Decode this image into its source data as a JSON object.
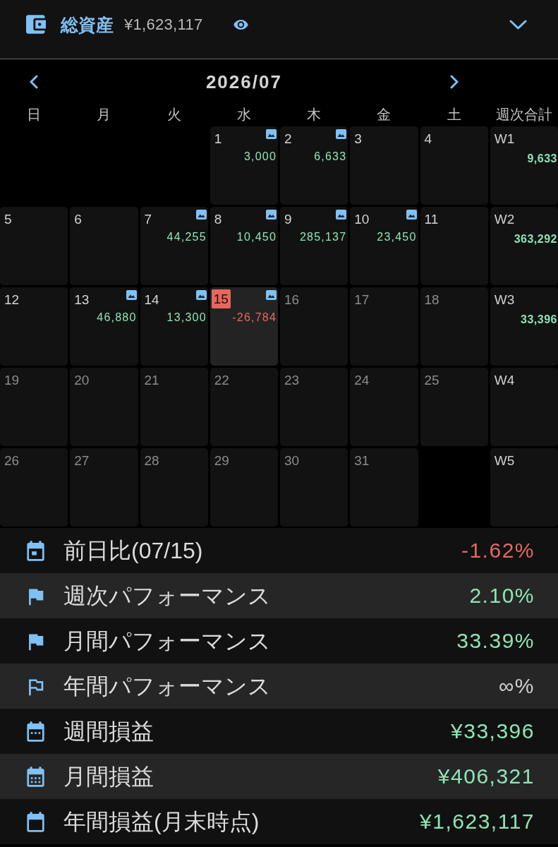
{
  "header": {
    "title": "総資産",
    "amount": "¥1,623,117"
  },
  "calendar": {
    "title": "2026/07",
    "weekdays": [
      "日",
      "月",
      "火",
      "水",
      "木",
      "金",
      "土"
    ],
    "week_total_heading": "週次合計",
    "weeks": [
      {
        "days": [
          {
            "date": "1",
            "value": "3,000",
            "negative": false,
            "has_image": true,
            "dimmed": false,
            "today": false,
            "selected": false
          },
          {
            "date": "2",
            "value": "6,633",
            "negative": false,
            "has_image": true,
            "dimmed": false,
            "today": false,
            "selected": false
          },
          {
            "date": "3",
            "has_image": false,
            "dimmed": false,
            "today": false,
            "selected": false
          },
          {
            "date": "4",
            "has_image": false,
            "dimmed": false,
            "today": false,
            "selected": false
          }
        ],
        "total": {
          "label": "W1",
          "value": "9,633",
          "negative": false
        }
      },
      {
        "days": [
          {
            "date": "5",
            "has_image": false,
            "dimmed": false,
            "today": false,
            "selected": false
          },
          {
            "date": "6",
            "has_image": false,
            "dimmed": false,
            "today": false,
            "selected": false
          },
          {
            "date": "7",
            "value": "44,255",
            "negative": false,
            "has_image": true,
            "dimmed": false,
            "today": false,
            "selected": false
          },
          {
            "date": "8",
            "value": "10,450",
            "negative": false,
            "has_image": true,
            "dimmed": false,
            "today": false,
            "selected": false
          },
          {
            "date": "9",
            "value": "285,137",
            "negative": false,
            "has_image": true,
            "dimmed": false,
            "today": false,
            "selected": false
          },
          {
            "date": "10",
            "value": "23,450",
            "negative": false,
            "has_image": true,
            "dimmed": false,
            "today": false,
            "selected": false
          },
          {
            "date": "11",
            "has_image": false,
            "dimmed": false,
            "today": false,
            "selected": false
          }
        ],
        "total": {
          "label": "W2",
          "value": "363,292",
          "negative": false
        }
      },
      {
        "days": [
          {
            "date": "12",
            "has_image": false,
            "dimmed": false,
            "today": false,
            "selected": false
          },
          {
            "date": "13",
            "value": "46,880",
            "negative": false,
            "has_image": true,
            "dimmed": false,
            "today": false,
            "selected": false
          },
          {
            "date": "14",
            "value": "13,300",
            "negative": false,
            "has_image": true,
            "dimmed": false,
            "today": false,
            "selected": false
          },
          {
            "date": "15",
            "value": "-26,784",
            "negative": true,
            "has_image": true,
            "dimmed": false,
            "today": true,
            "selected": true
          },
          {
            "date": "16",
            "has_image": false,
            "dimmed": true,
            "today": false,
            "selected": false
          },
          {
            "date": "17",
            "has_image": false,
            "dimmed": true,
            "today": false,
            "selected": false
          },
          {
            "date": "18",
            "has_image": false,
            "dimmed": true,
            "today": false,
            "selected": false
          }
        ],
        "total": {
          "label": "W3",
          "value": "33,396",
          "negative": false
        }
      },
      {
        "days": [
          {
            "date": "19",
            "has_image": false,
            "dimmed": true,
            "today": false,
            "selected": false
          },
          {
            "date": "20",
            "has_image": false,
            "dimmed": true,
            "today": false,
            "selected": false
          },
          {
            "date": "21",
            "has_image": false,
            "dimmed": true,
            "today": false,
            "selected": false
          },
          {
            "date": "22",
            "has_image": false,
            "dimmed": true,
            "today": false,
            "selected": false
          },
          {
            "date": "23",
            "has_image": false,
            "dimmed": true,
            "today": false,
            "selected": false
          },
          {
            "date": "24",
            "has_image": false,
            "dimmed": true,
            "today": false,
            "selected": false
          },
          {
            "date": "25",
            "has_image": false,
            "dimmed": true,
            "today": false,
            "selected": false
          }
        ],
        "total": {
          "label": "W4"
        }
      },
      {
        "days": [
          {
            "date": "26",
            "has_image": false,
            "dimmed": true,
            "today": false,
            "selected": false
          },
          {
            "date": "27",
            "has_image": false,
            "dimmed": true,
            "today": false,
            "selected": false
          },
          {
            "date": "28",
            "has_image": false,
            "dimmed": true,
            "today": false,
            "selected": false
          },
          {
            "date": "29",
            "has_image": false,
            "dimmed": true,
            "today": false,
            "selected": false
          },
          {
            "date": "30",
            "has_image": false,
            "dimmed": true,
            "today": false,
            "selected": false
          },
          {
            "date": "31",
            "has_image": false,
            "dimmed": true,
            "today": false,
            "selected": false
          }
        ],
        "total": {
          "label": "W5"
        }
      }
    ]
  },
  "stats": [
    {
      "label": "前日比(07/15)",
      "value": "-1.62%",
      "negative": true,
      "neutral": false
    },
    {
      "label": "週次パフォーマンス",
      "value": "2.10%",
      "negative": false,
      "neutral": false
    },
    {
      "label": "月間パフォーマンス",
      "value": "33.39%",
      "negative": false,
      "neutral": false
    },
    {
      "label": "年間パフォーマンス",
      "value": "∞%",
      "negative": false,
      "neutral": true
    },
    {
      "label": "週間損益",
      "value": "¥33,396",
      "negative": false,
      "neutral": false
    },
    {
      "label": "月間損益",
      "value": "¥406,321",
      "negative": false,
      "neutral": false
    },
    {
      "label": "年間損益(月末時点)",
      "value": "¥1,623,117",
      "negative": false,
      "neutral": false
    }
  ]
}
